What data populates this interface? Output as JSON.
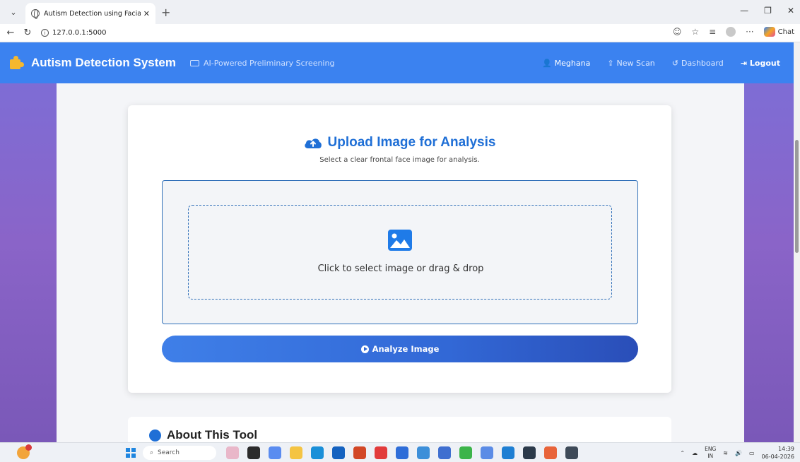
{
  "browser": {
    "tab_title": "Autism Detection using Facial Feat",
    "url": "127.0.0.1:5000",
    "chat_label": "Chat"
  },
  "navbar": {
    "brand": "Autism Detection System",
    "tagline": "AI-Powered Preliminary Screening",
    "user": "Meghana",
    "new_scan": "New Scan",
    "dashboard": "Dashboard",
    "logout": "Logout"
  },
  "upload": {
    "title": "Upload Image for Analysis",
    "subtitle": "Select a clear frontal face image for analysis.",
    "drop_text": "Click to select image or drag & drop",
    "analyze_label": "Analyze Image"
  },
  "about": {
    "title": "About This Tool"
  },
  "taskbar": {
    "search_label": "Search",
    "lang": "ENG",
    "region": "IN",
    "time": "14:39",
    "date": "06-04-2026"
  },
  "colors": {
    "navbar": "#3b82f0",
    "accent": "#1f6fd6",
    "brand_icon": "#f5b82e",
    "background": "#8a64c8"
  }
}
